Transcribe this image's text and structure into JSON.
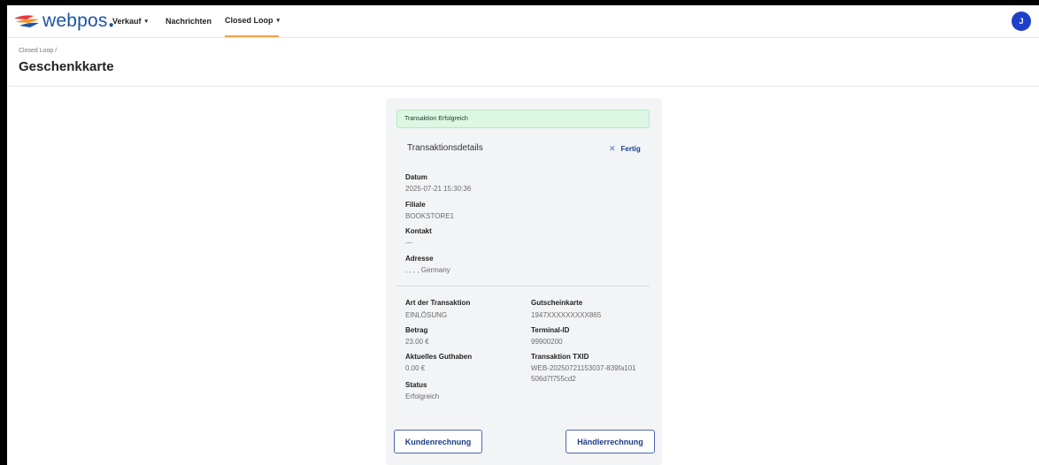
{
  "brand": {
    "name": "webpos",
    "suffix": "●"
  },
  "nav": {
    "items": [
      {
        "label": "Verkauf",
        "caret": "▾"
      },
      {
        "label": "Nachrichten"
      },
      {
        "label": "Closed Loop",
        "caret": "▾"
      }
    ]
  },
  "user": {
    "initial": "J"
  },
  "breadcrumb": "Closed Loop /",
  "page_title": "Geschenkkarte",
  "alert": "Transaktion Erfolgreich",
  "details": {
    "title": "Transaktionsdetails",
    "done_label": "Fertig",
    "datum_label": "Datum",
    "datum_value": "2025-07-21 15:30:36",
    "filiale_label": "Filiale",
    "filiale_value": "BOOKSTORE1",
    "kontakt_label": "Kontakt",
    "kontakt_value": "---",
    "adresse_label": "Adresse",
    "adresse_value": ", , , , Germany"
  },
  "tx": {
    "art_label": "Art der Transaktion",
    "art_value": "EINLÖSUNG",
    "betrag_label": "Betrag",
    "betrag_value": "23.00 €",
    "guthaben_label": "Aktuelles Guthaben",
    "guthaben_value": "0.00 €",
    "status_label": "Status",
    "status_value": "Erfolgreich",
    "karte_label": "Gutscheinkarte",
    "karte_value": "1947XXXXXXXXX865",
    "terminal_label": "Terminal-ID",
    "terminal_value": "99900200",
    "txid_label": "Transaktion TXID",
    "txid_line1": "WEB-20250721153037-839fa101",
    "txid_line2": "506d7f755cd2"
  },
  "buttons": {
    "customer": "Kundenrechnung",
    "merchant": "Händlerrechnung"
  },
  "colors": {
    "accent": "#f5a142",
    "brand": "#1b55a6",
    "avatar": "#1e40c9",
    "success_bg": "#dcf7e4"
  }
}
